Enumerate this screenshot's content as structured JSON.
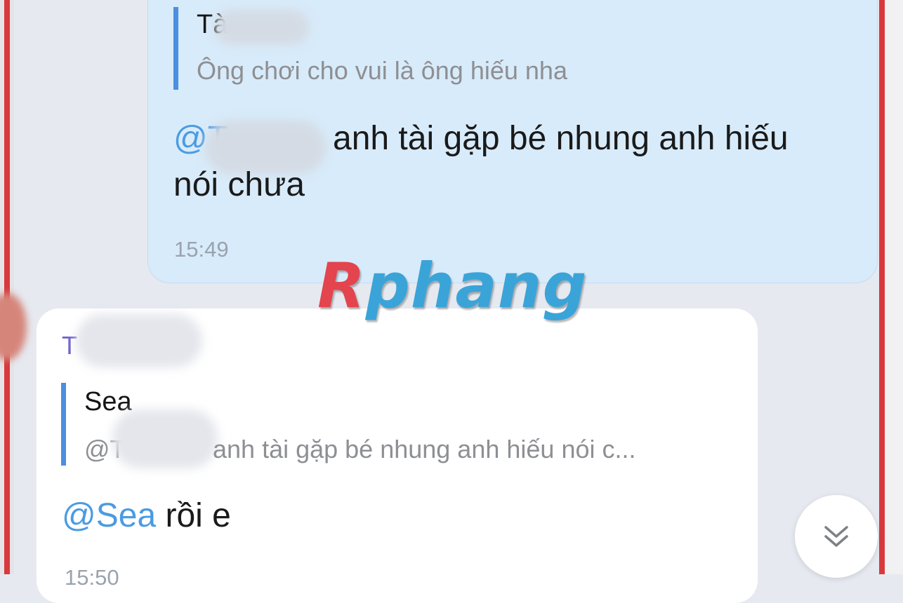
{
  "sent_message": {
    "quote": {
      "sender_visible": "Tà",
      "text": "Ông chơi cho vui là ông hiếu nha"
    },
    "mention_prefix": "@T",
    "text_line1": "anh tài gặp bé nhung anh hiếu",
    "text_line2": "nói chưa",
    "time": "15:49"
  },
  "received_message": {
    "sender_visible": "T",
    "quote": {
      "sender": "Sea",
      "text_prefix": "@T",
      "text": "anh tài gặp bé nhung anh hiếu nói c..."
    },
    "mention": "@Sea",
    "text": " rồi e",
    "time_partial": "15:50"
  },
  "watermark": {
    "part1": "R",
    "part2": "phang"
  },
  "scroll_button": {
    "icon": "double-chevron-down-icon"
  },
  "colors": {
    "frame_red": "#d8393d",
    "mention_blue": "#4a9be2",
    "sender_purple": "#6a5fd0",
    "sent_bubble": "#d8ebfa",
    "quote_bar": "#4a8fe0"
  }
}
